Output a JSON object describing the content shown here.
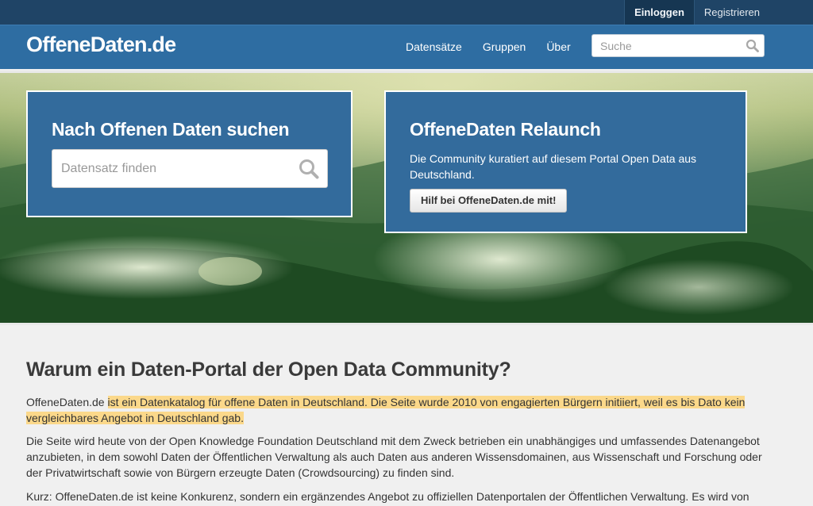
{
  "account": {
    "login_label": "Einloggen",
    "register_label": "Registrieren"
  },
  "header": {
    "logo": "OffeneDaten.de",
    "nav": [
      {
        "label": "Datensätze"
      },
      {
        "label": "Gruppen"
      },
      {
        "label": "Über"
      }
    ],
    "search_placeholder": "Suche"
  },
  "hero": {
    "search_panel": {
      "title": "Nach Offenen Daten suchen",
      "placeholder": "Datensatz finden"
    },
    "relaunch_panel": {
      "title": "OffeneDaten Relaunch",
      "text": "Die Community kuratiert auf diesem Portal Open Data aus Deutschland.",
      "button_label": "Hilf bei OffeneDaten.de mit!"
    }
  },
  "main": {
    "heading": "Warum ein Daten-Portal der Open Data Community?",
    "p1_lead": "OffeneDaten.de",
    "p1_highlight": "ist ein Datenkatalog für offene Daten in Deutschland. Die Seite wurde 2010 von engagierten Bürgern initiiert, weil es bis Dato kein vergleichbares Angebot in Deutschland gab.",
    "p2": "Die Seite wird heute von der Open Knowledge Foundation Deutschland mit dem Zweck betrieben ein unabhängiges und umfassendes Datenangebot anzubieten, in dem sowohl Daten der Öffentlichen Verwaltung als auch Daten aus anderen Wissensdomainen, aus Wissenschaft und Forschung oder der Privatwirtschaft sowie von Bürgern erzeugte Daten (Crowdsourcing) zu finden sind.",
    "p3": "Kurz: OffeneDaten.de ist keine Konkurenz, sondern ein ergänzendes Angebot zu offiziellen Datenportalen der Öffentlichen Verwaltung. Es wird von"
  },
  "colors": {
    "top_bar": "#1f4466",
    "nav_bar": "#2e6da2",
    "panel": "#336b9c",
    "highlight": "#fbd88a"
  },
  "icons": [
    "search-icon"
  ]
}
